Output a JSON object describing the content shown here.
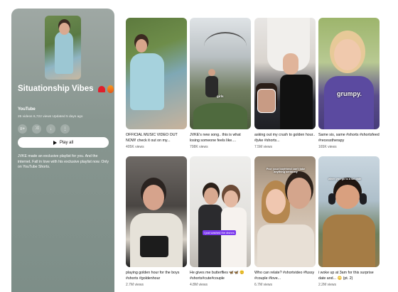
{
  "playlist": {
    "title": "Situationship Vibes",
    "channel": "YouTube",
    "meta": "25 videos  6,722 views  Updated 5 days ago",
    "play_label": "Play all",
    "description": "JVKE made an exclusive playlist for you. And the internet. Fall in love with his exclusive playlist now. Only on YouTube Shorts.",
    "action_icons": [
      "add-to-queue-icon",
      "shuffle-icon",
      "download-icon",
      "more-icon"
    ]
  },
  "videos": [
    {
      "title": "OFFICIAL MUSIC VIDEO OUT NOW! check it out on my...",
      "views": "405K views"
    },
    {
      "title": "JVKE's new song.. this is what losing someone feels like....",
      "views": "708K views",
      "overlay": "girls"
    },
    {
      "title": "asking out my crush to golden hour.. #jvke #shorts...",
      "views": "7.5M views"
    },
    {
      "title": "Same sis, same #shorts #shortsfeed #recesstherapy",
      "views": "165K views",
      "overlay": "grumpy."
    },
    {
      "title": "playing golden hour for the boys #shorts #goldenhour",
      "views": "2.7M views"
    },
    {
      "title": "He gives me butterflies 🦋🦋 😊 #shorts#cute#couple",
      "views": "4.8M views",
      "overlay": "I just washed the dishes"
    },
    {
      "title": "Who can relate? #shortvideo #fussy #couple #love...",
      "views": "6.7M views",
      "overlay": "Pov: your boyfriend can't take anything seriously"
    },
    {
      "title": "i woke up at 3am for this surprise date and... 😳 (pt. 2)",
      "views": "2.2M views",
      "overlay": "when you go to a ski date"
    }
  ]
}
